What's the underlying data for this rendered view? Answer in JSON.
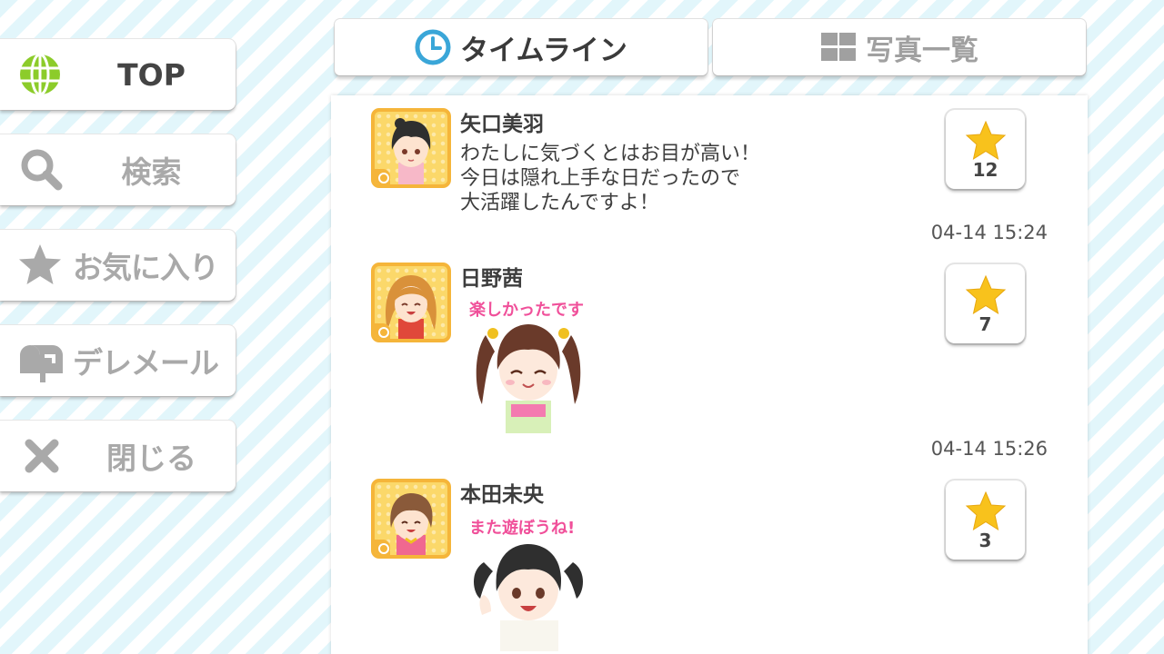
{
  "sidebar": {
    "items": [
      {
        "label": "TOP",
        "icon": "globe-icon",
        "active": true
      },
      {
        "label": "検索",
        "icon": "search-icon"
      },
      {
        "label": "お気に入り",
        "icon": "star-icon"
      },
      {
        "label": "デレメール",
        "icon": "mailbox-icon"
      },
      {
        "label": "閉じる",
        "icon": "close-icon"
      }
    ]
  },
  "tabs": [
    {
      "label": "タイムライン",
      "icon": "clock-icon",
      "active": true
    },
    {
      "label": "写真一覧",
      "icon": "grid-icon",
      "active": false
    }
  ],
  "timeline": [
    {
      "name": "矢口美羽",
      "message": [
        "わたしに気づくとはお目が高い！",
        "今日は隠れ上手な日だったので",
        "大活躍したんですよ！"
      ],
      "likes": "12",
      "time": "04-14 15:24"
    },
    {
      "name": "日野茜",
      "sticker_text": "楽しかったです",
      "likes": "7",
      "time": "04-14 15:26"
    },
    {
      "name": "本田未央",
      "sticker_text": "また遊ぼうね!",
      "likes": "3"
    }
  ],
  "colors": {
    "accent_green": "#8ccc2a",
    "star_gold": "#f8c21c",
    "avatar_frame": "#f5b53a",
    "sticker_text": "#f0509a",
    "stripe": "#e2f6fb"
  }
}
